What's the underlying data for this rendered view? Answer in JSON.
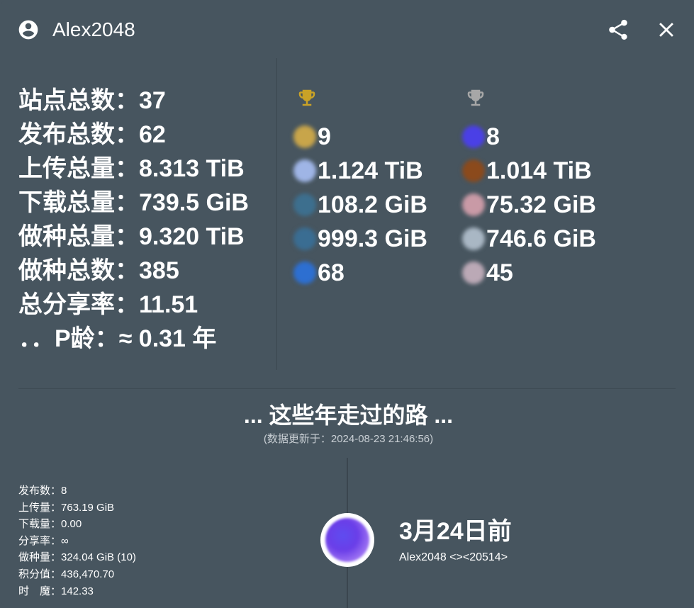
{
  "header": {
    "username": "Alex2048",
    "icons": {
      "user": "account-circle-icon",
      "share": "share-icon",
      "close": "close-icon"
    }
  },
  "summary": {
    "stats": [
      {
        "label": "站点总数：",
        "value": "37"
      },
      {
        "label": "发布总数：",
        "value": "62"
      },
      {
        "label": "上传总量：",
        "value": "8.313 TiB"
      },
      {
        "label": "下载总量：",
        "value": "739.5 GiB"
      },
      {
        "label": "做种总量：",
        "value": "9.320 TiB"
      },
      {
        "label": "做种总数：",
        "value": "385"
      },
      {
        "label": "总分享率：",
        "value": "11.51"
      },
      {
        "label": "．．P龄：",
        "value": "≈ 0.31 年"
      }
    ]
  },
  "top_sites": {
    "gold": {
      "trophy_icon": "trophy-gold-icon",
      "trophy_color": "#c9a227",
      "rows": [
        {
          "value": "9",
          "color": "#c8a54a"
        },
        {
          "value": "1.124 TiB",
          "color": "#9fb5e6"
        },
        {
          "value": "108.2 GiB",
          "color": "#3d6f8e"
        },
        {
          "value": "999.3 GiB",
          "color": "#3a6d92"
        },
        {
          "value": "68",
          "color": "#2d6fd1"
        }
      ]
    },
    "silver": {
      "trophy_icon": "trophy-silver-icon",
      "trophy_color": "#a7a7a7",
      "rows": [
        {
          "value": "8",
          "color": "#4a40e6"
        },
        {
          "value": "1.014 TiB",
          "color": "#8b4a1c"
        },
        {
          "value": "75.32 GiB",
          "color": "#c99aa6"
        },
        {
          "value": "746.6 GiB",
          "color": "#a9b7c4"
        },
        {
          "value": "45",
          "color": "#bba9b6"
        }
      ]
    }
  },
  "journey": {
    "title": "... 这些年走过的路 ...",
    "updated": "(数据更新于：2024-08-23 21:46:56)"
  },
  "event": {
    "details": [
      {
        "label": "发布数：",
        "value": "8"
      },
      {
        "label": "上传量：",
        "value": "763.19 GiB"
      },
      {
        "label": "下载量：",
        "value": "0.00"
      },
      {
        "label": "分享率：",
        "value": "∞"
      },
      {
        "label": "做种量：",
        "value": "324.04 GiB (10)"
      },
      {
        "label": "积分值：",
        "value": "436,470.70"
      },
      {
        "label": "时　魔：",
        "value": "142.33"
      }
    ],
    "when": "3月24日前",
    "user_line": "Alex2048   <><20514>"
  },
  "colors": {
    "background": "#47555f",
    "text": "#ffffff"
  }
}
